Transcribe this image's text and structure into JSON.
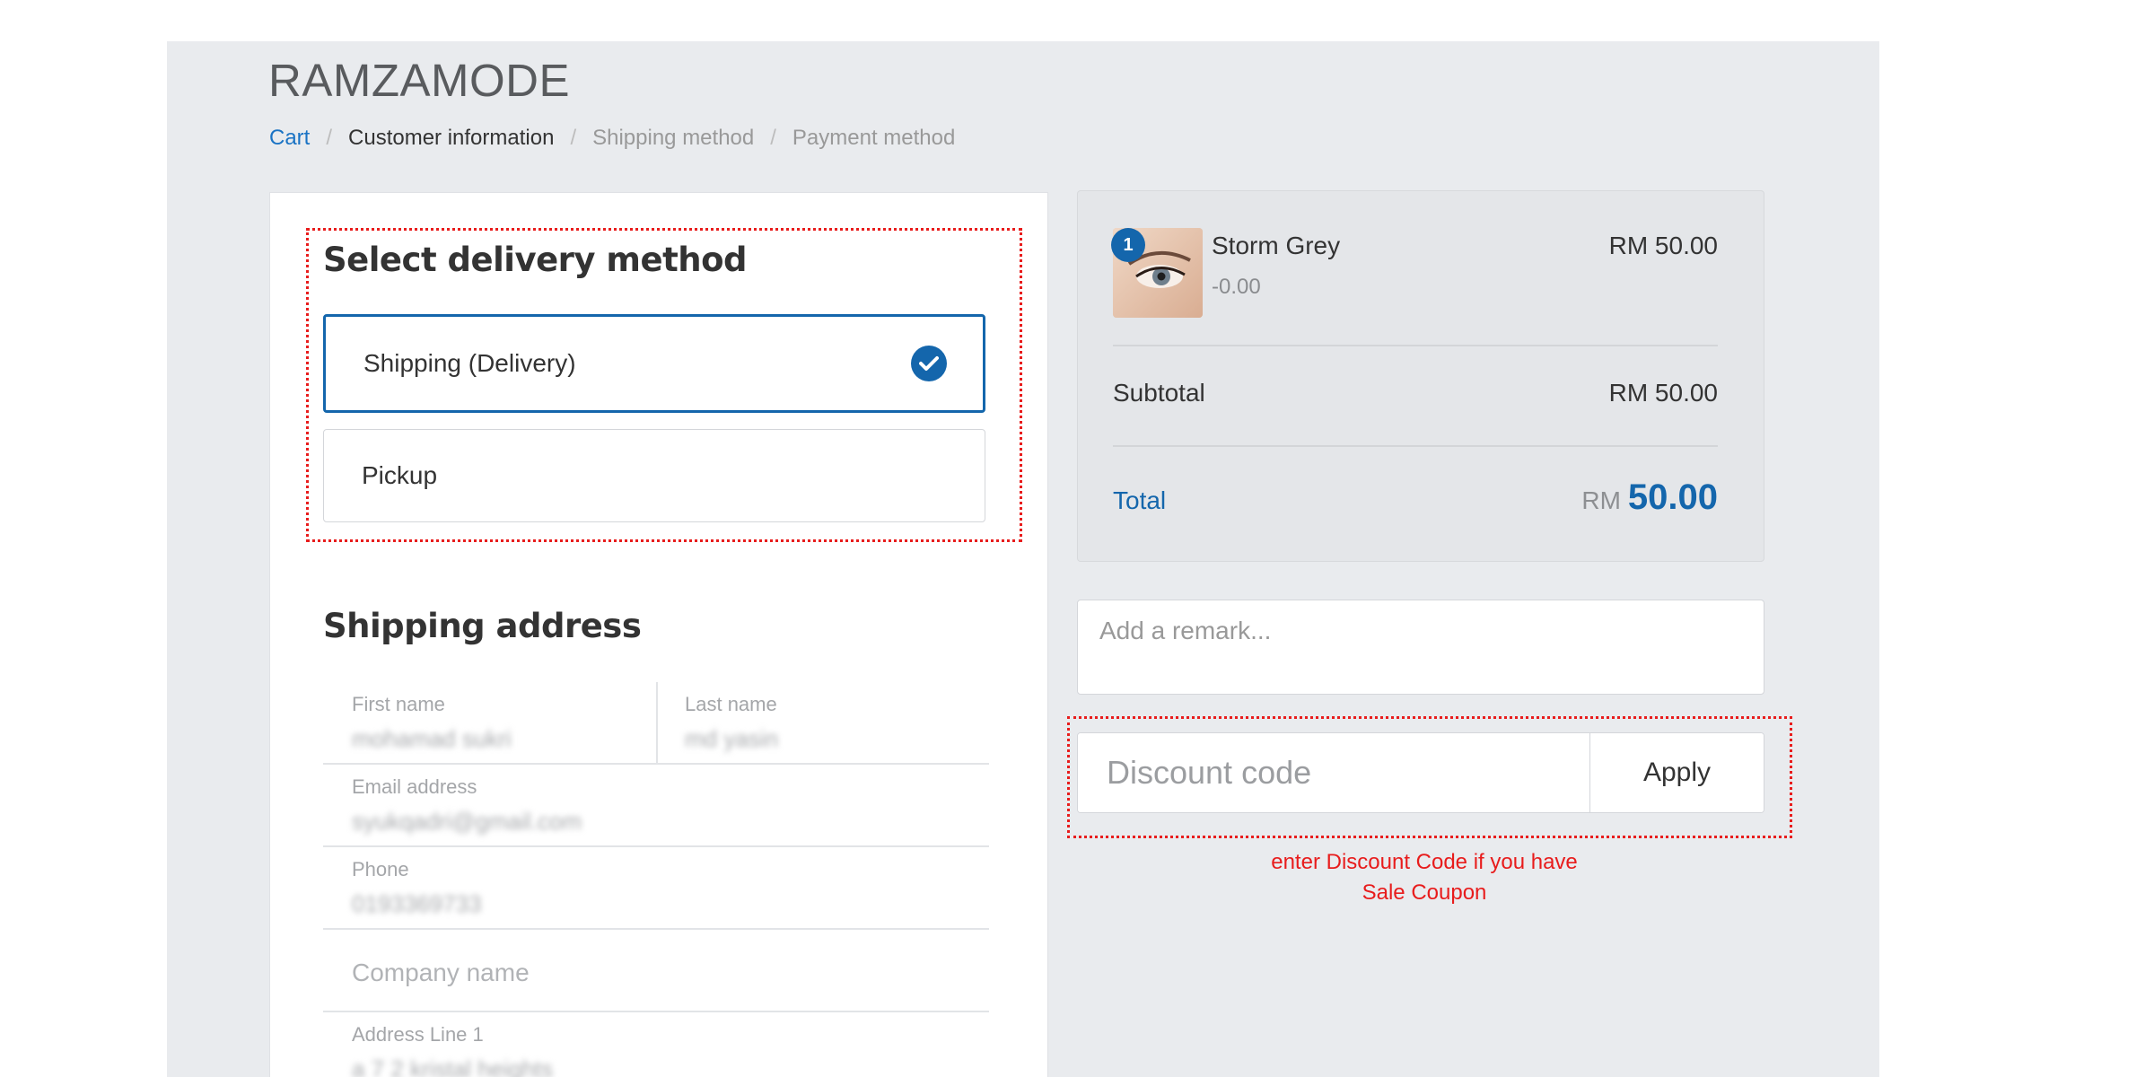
{
  "store": {
    "name": "RAMZAMODE"
  },
  "breadcrumb": {
    "items": [
      {
        "label": "Cart"
      },
      {
        "label": "Customer information"
      },
      {
        "label": "Shipping method"
      },
      {
        "label": "Payment method"
      }
    ],
    "separator": "/"
  },
  "delivery": {
    "title": "Select delivery method",
    "options": [
      {
        "label": "Shipping (Delivery)",
        "selected": true
      },
      {
        "label": "Pickup",
        "selected": false
      }
    ]
  },
  "address": {
    "title": "Shipping address",
    "first_name": {
      "label": "First name",
      "value": "mohamad sukri"
    },
    "last_name": {
      "label": "Last name",
      "value": "md yasin"
    },
    "email": {
      "label": "Email address",
      "value": "syukqadri@gmail.com"
    },
    "phone": {
      "label": "Phone",
      "value": "0193369733"
    },
    "company": {
      "placeholder": "Company name"
    },
    "address1": {
      "label": "Address Line 1",
      "value": "a 7 2 kristal heights"
    }
  },
  "summary": {
    "item": {
      "name": "Storm Grey",
      "discount": "-0.00",
      "price": "RM 50.00",
      "quantity": "1"
    },
    "subtotal_label": "Subtotal",
    "subtotal_value": "RM 50.00",
    "total_label": "Total",
    "total_currency": "RM",
    "total_amount": "50.00"
  },
  "remark": {
    "placeholder": "Add a remark..."
  },
  "discount": {
    "placeholder": "Discount code",
    "apply_label": "Apply"
  },
  "annotation": {
    "line1": "enter Discount Code if you have",
    "line2": "Sale Coupon"
  },
  "colors": {
    "accent": "#1466ac",
    "link": "#1a73c4",
    "annotation": "#e81c1c",
    "page_bg": "#e9ebee"
  }
}
